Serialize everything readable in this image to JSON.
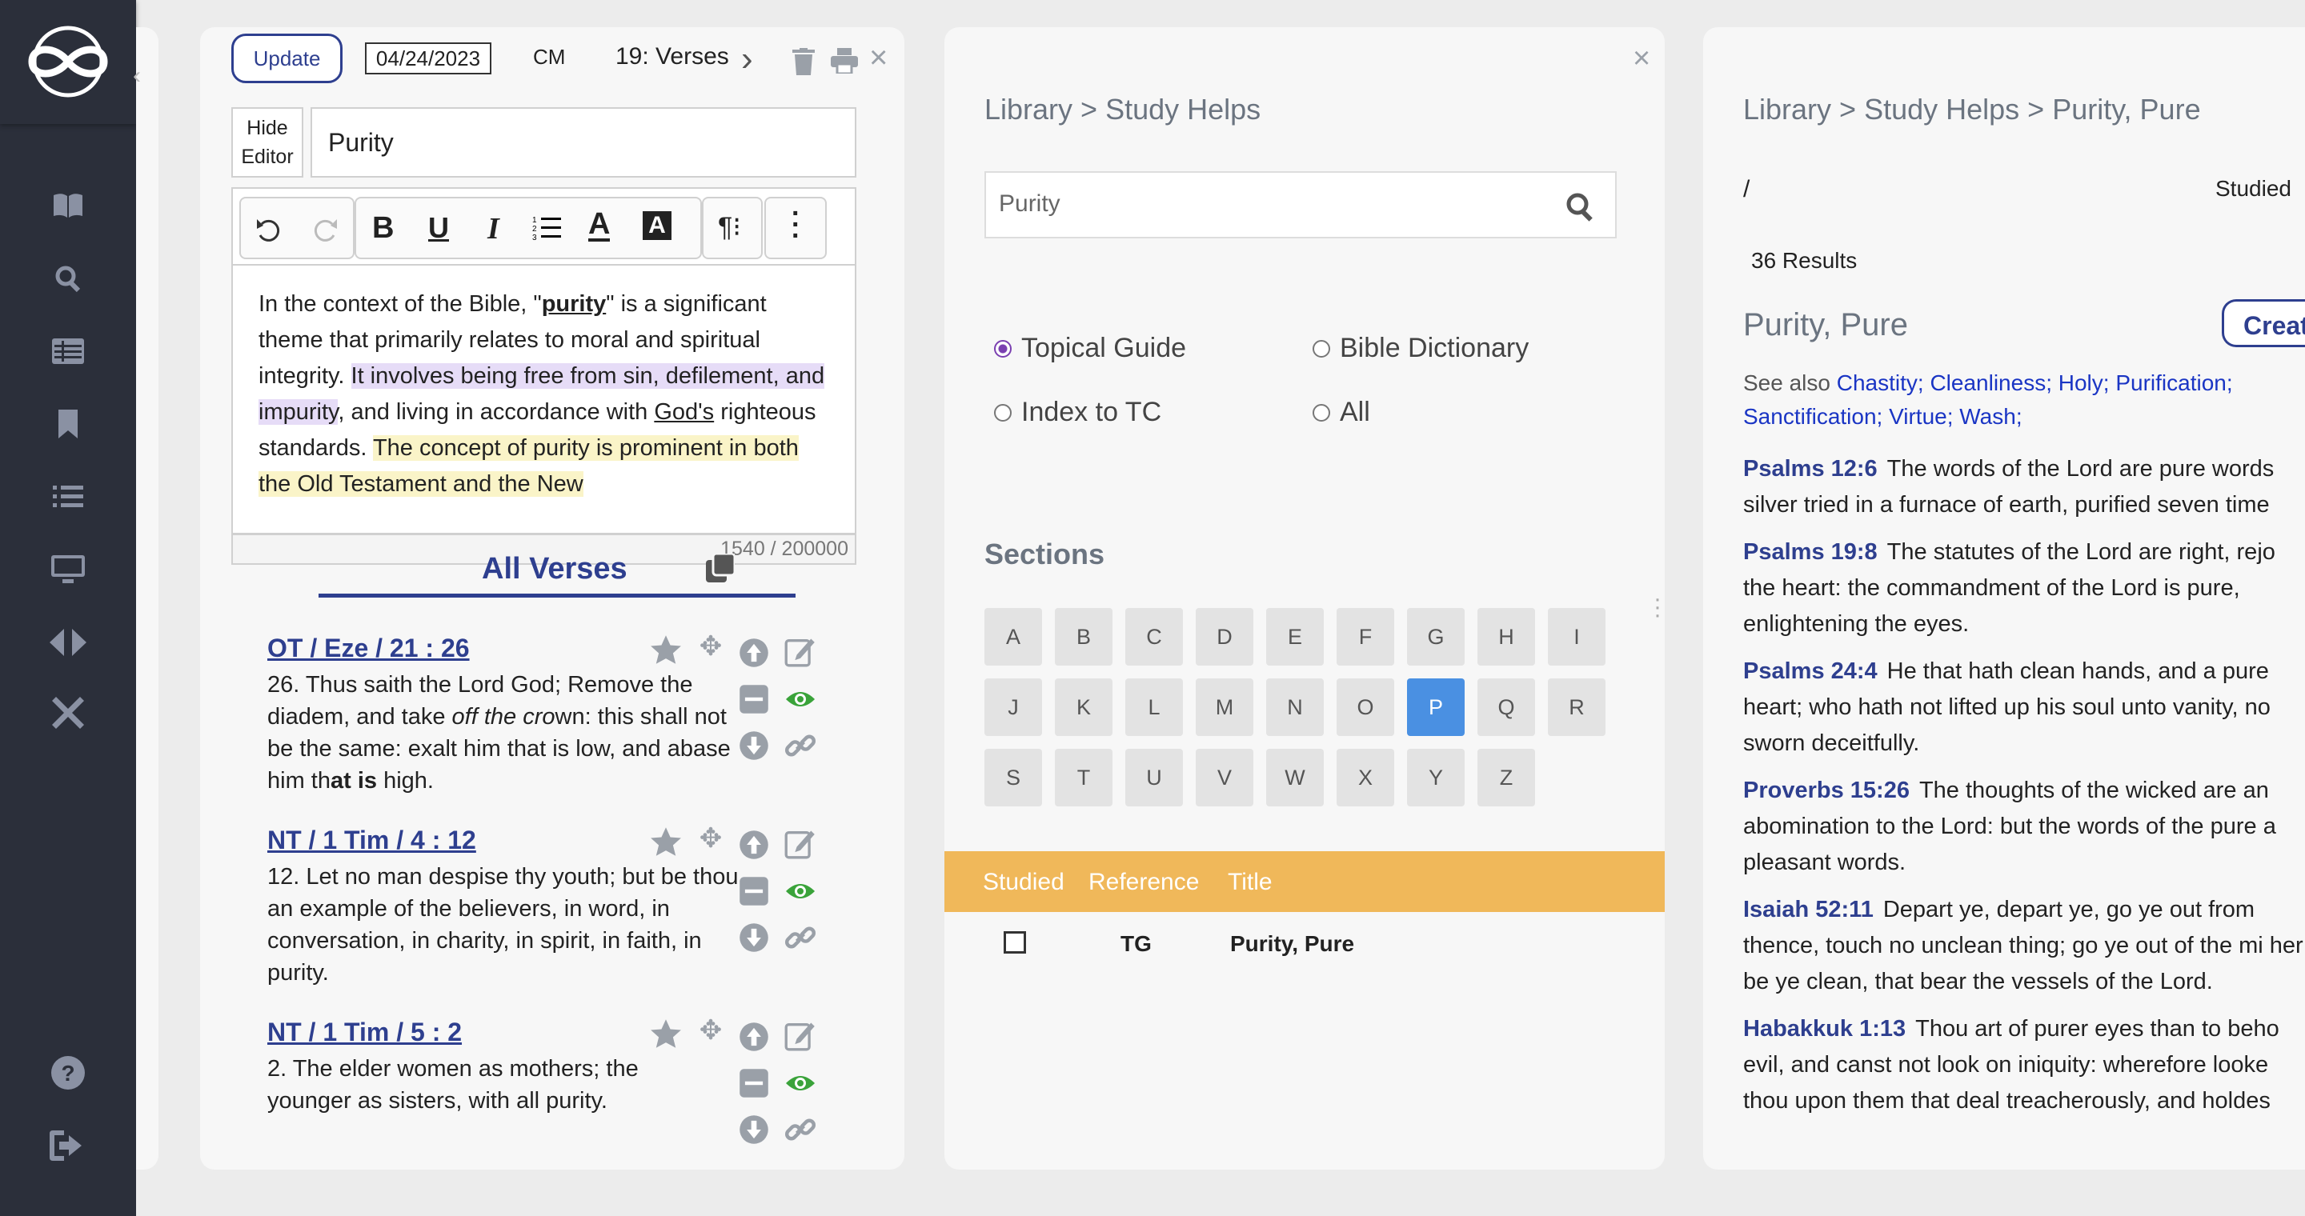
{
  "editor": {
    "update_label": "Update",
    "date_value": "04/24/2023",
    "user_initials": "CM",
    "verse_count_label": "19: Verses",
    "hide_editor_line1": "Hide",
    "hide_editor_line2": "Editor",
    "title_value": "Purity",
    "body": {
      "p1": "In the context of the Bible, \"",
      "p2_bold": "purity",
      "p3": "\" is a significant theme that primarily relates to moral and spiritual integrity. ",
      "p4_hl": "It involves being free from sin, defilement, and impurity",
      "p5": ", and living in accordance with ",
      "p6_u": "God's",
      "p7": " righteous standards. ",
      "p8_hl": "The concept of purity is prominent in both the Old Testament and the New"
    },
    "char_count": "1540 / 200000",
    "all_verses_label": "All Verses"
  },
  "verses": [
    {
      "ref": "OT / Eze / 21 : 26",
      "t1": "26. Thus saith the Lord God; Remove the diadem, and take ",
      "t2_i": "off the cro",
      "t3": "wn: this shall not be the same: exalt him that is low, and abase him th",
      "t4_b": "at is",
      "t5": " high."
    },
    {
      "ref": "NT / 1 Tim / 4 : 12",
      "t1": "12. Let no man despise thy youth; but be thou an example of the believers, in word, in conversation, in charity, in spirit, in faith, in purity.",
      "t2_i": "",
      "t3": "",
      "t4_b": "",
      "t5": ""
    },
    {
      "ref": "NT / 1 Tim / 5 : 2",
      "t1": "2. The elder women as mothers; the younger as sisters, with all purity.",
      "t2_i": "",
      "t3": "",
      "t4_b": "",
      "t5": ""
    }
  ],
  "library": {
    "breadcrumb": "Library > Study Helps",
    "search_value": "Purity",
    "options": [
      "Topical Guide",
      "Bible Dictionary",
      "Index to TC",
      "All"
    ],
    "sections_label": "Sections",
    "letters": [
      "A",
      "B",
      "C",
      "D",
      "E",
      "F",
      "G",
      "H",
      "I",
      "J",
      "K",
      "L",
      "M",
      "N",
      "O",
      "P",
      "Q",
      "R",
      "S",
      "T",
      "U",
      "V",
      "W",
      "X",
      "Y",
      "Z"
    ],
    "active_letter": "P",
    "table_headers": [
      "Studied",
      "Reference",
      "Title"
    ],
    "row": {
      "reference": "TG",
      "title": "Purity, Pure"
    }
  },
  "detail": {
    "breadcrumb": "Library > Study Helps > Purity, Pure",
    "slash": "/",
    "studied_label": "Studied",
    "results": "36 Results",
    "heading": "Purity, Pure",
    "create_label": "Creat",
    "see_also_label": "See also",
    "see_also_links": "Chastity; Cleanliness; Holy; Purification; Sanctification; Virtue; Wash;",
    "entries": [
      {
        "ref": "Psalms 12:6",
        "text": "The words of the Lord are pure words silver tried in a furnace of earth, purified seven time"
      },
      {
        "ref": "Psalms 19:8",
        "text": "The statutes of the Lord are right, rejo the heart: the commandment of the Lord is pure, enlightening the eyes."
      },
      {
        "ref": "Psalms 24:4",
        "text": "He that hath clean hands, and a pure heart; who hath not lifted up his soul unto vanity, no sworn deceitfully."
      },
      {
        "ref": "Proverbs 15:26",
        "text": "The thoughts of the wicked are an abomination to the Lord: but the words of the pure a pleasant words."
      },
      {
        "ref": "Isaiah 52:11",
        "text": "Depart ye, depart ye, go ye out from thence, touch no unclean thing; go ye out of the mi her; be ye clean, that bear the vessels of the Lord."
      },
      {
        "ref": "Habakkuk 1:13",
        "text": "Thou art of purer eyes than to beho evil, and canst not look on iniquity: wherefore looke thou upon them that deal treacherously, and holdes"
      }
    ]
  },
  "colors": {
    "sidebar": "#2b2f3a",
    "navy": "#2e3f8f",
    "table_header": "#f0b85a",
    "active_letter": "#4a90e2",
    "eye": "#3aa33a"
  }
}
